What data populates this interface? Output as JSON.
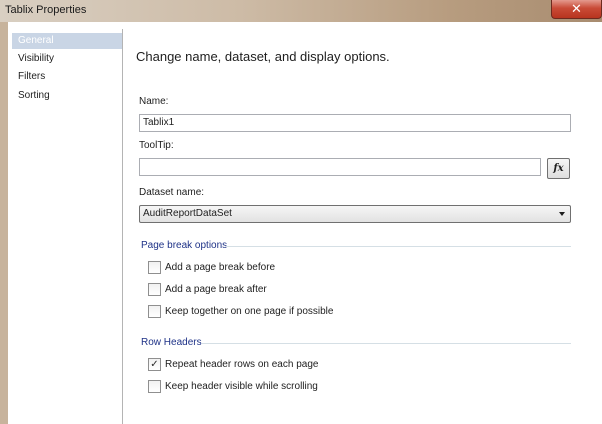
{
  "window": {
    "title": "Tablix Properties",
    "close_glyph": "✕"
  },
  "sidebar": {
    "items": [
      {
        "label": "General",
        "selected": true
      },
      {
        "label": "Visibility",
        "selected": false
      },
      {
        "label": "Filters",
        "selected": false
      },
      {
        "label": "Sorting",
        "selected": false
      }
    ]
  },
  "main": {
    "heading": "Change name, dataset, and display options.",
    "name_label": "Name:",
    "name_value": "Tablix1",
    "tooltip_label": "ToolTip:",
    "tooltip_value": "",
    "fx_label": "fx",
    "dataset_label": "Dataset name:",
    "dataset_value": "AuditReportDataSet",
    "page_break": {
      "title": "Page break options",
      "options": [
        {
          "label": "Add a page break before",
          "checked": false
        },
        {
          "label": "Add a page break after",
          "checked": false
        },
        {
          "label": "Keep together on one page if possible",
          "checked": false
        }
      ]
    },
    "row_headers": {
      "title": "Row Headers",
      "options": [
        {
          "label": "Repeat header rows on each page",
          "checked": true
        },
        {
          "label": "Keep header visible while scrolling",
          "checked": false
        }
      ]
    }
  },
  "colors": {
    "selection": "#c9d5e5",
    "group_title": "#1e3287",
    "close_button": "#c94b37"
  },
  "icons": {
    "checkmark": "✓",
    "dropdown": "chevron-down-icon"
  }
}
